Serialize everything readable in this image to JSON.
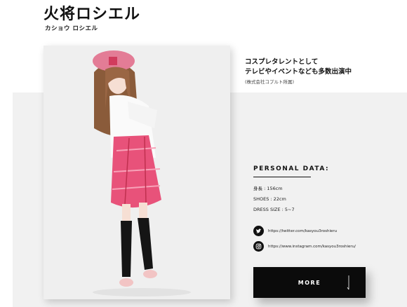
{
  "profile": {
    "name": "火将ロシエル",
    "name_kana": "カショウ ロシエル",
    "intro_lines": [
      "コスプレタレントとして",
      "テレビやイベントなども多数出演中"
    ],
    "agency": "(株式会社コプルト所属)"
  },
  "personal_data": {
    "heading": "PERSONAL DATA:",
    "height": "身長 : 156cm",
    "shoes": "SHOES : 22cm",
    "dress_size": "DRESS SIZE : 5~7"
  },
  "social": {
    "twitter_url": "https://twitter.com/kasyou3roshieru",
    "instagram_url": "https://www.instagram.com/kasyou3roshieru/",
    "twitter_icon": "twitter-icon",
    "instagram_icon": "instagram-icon"
  },
  "more_button": {
    "label": "MORE",
    "arrow_icon": "arrow-down-icon"
  },
  "colors": {
    "accent_pink": "#e8527a",
    "button_bg": "#0b0b0b",
    "band_bg": "#f1f1f1"
  }
}
